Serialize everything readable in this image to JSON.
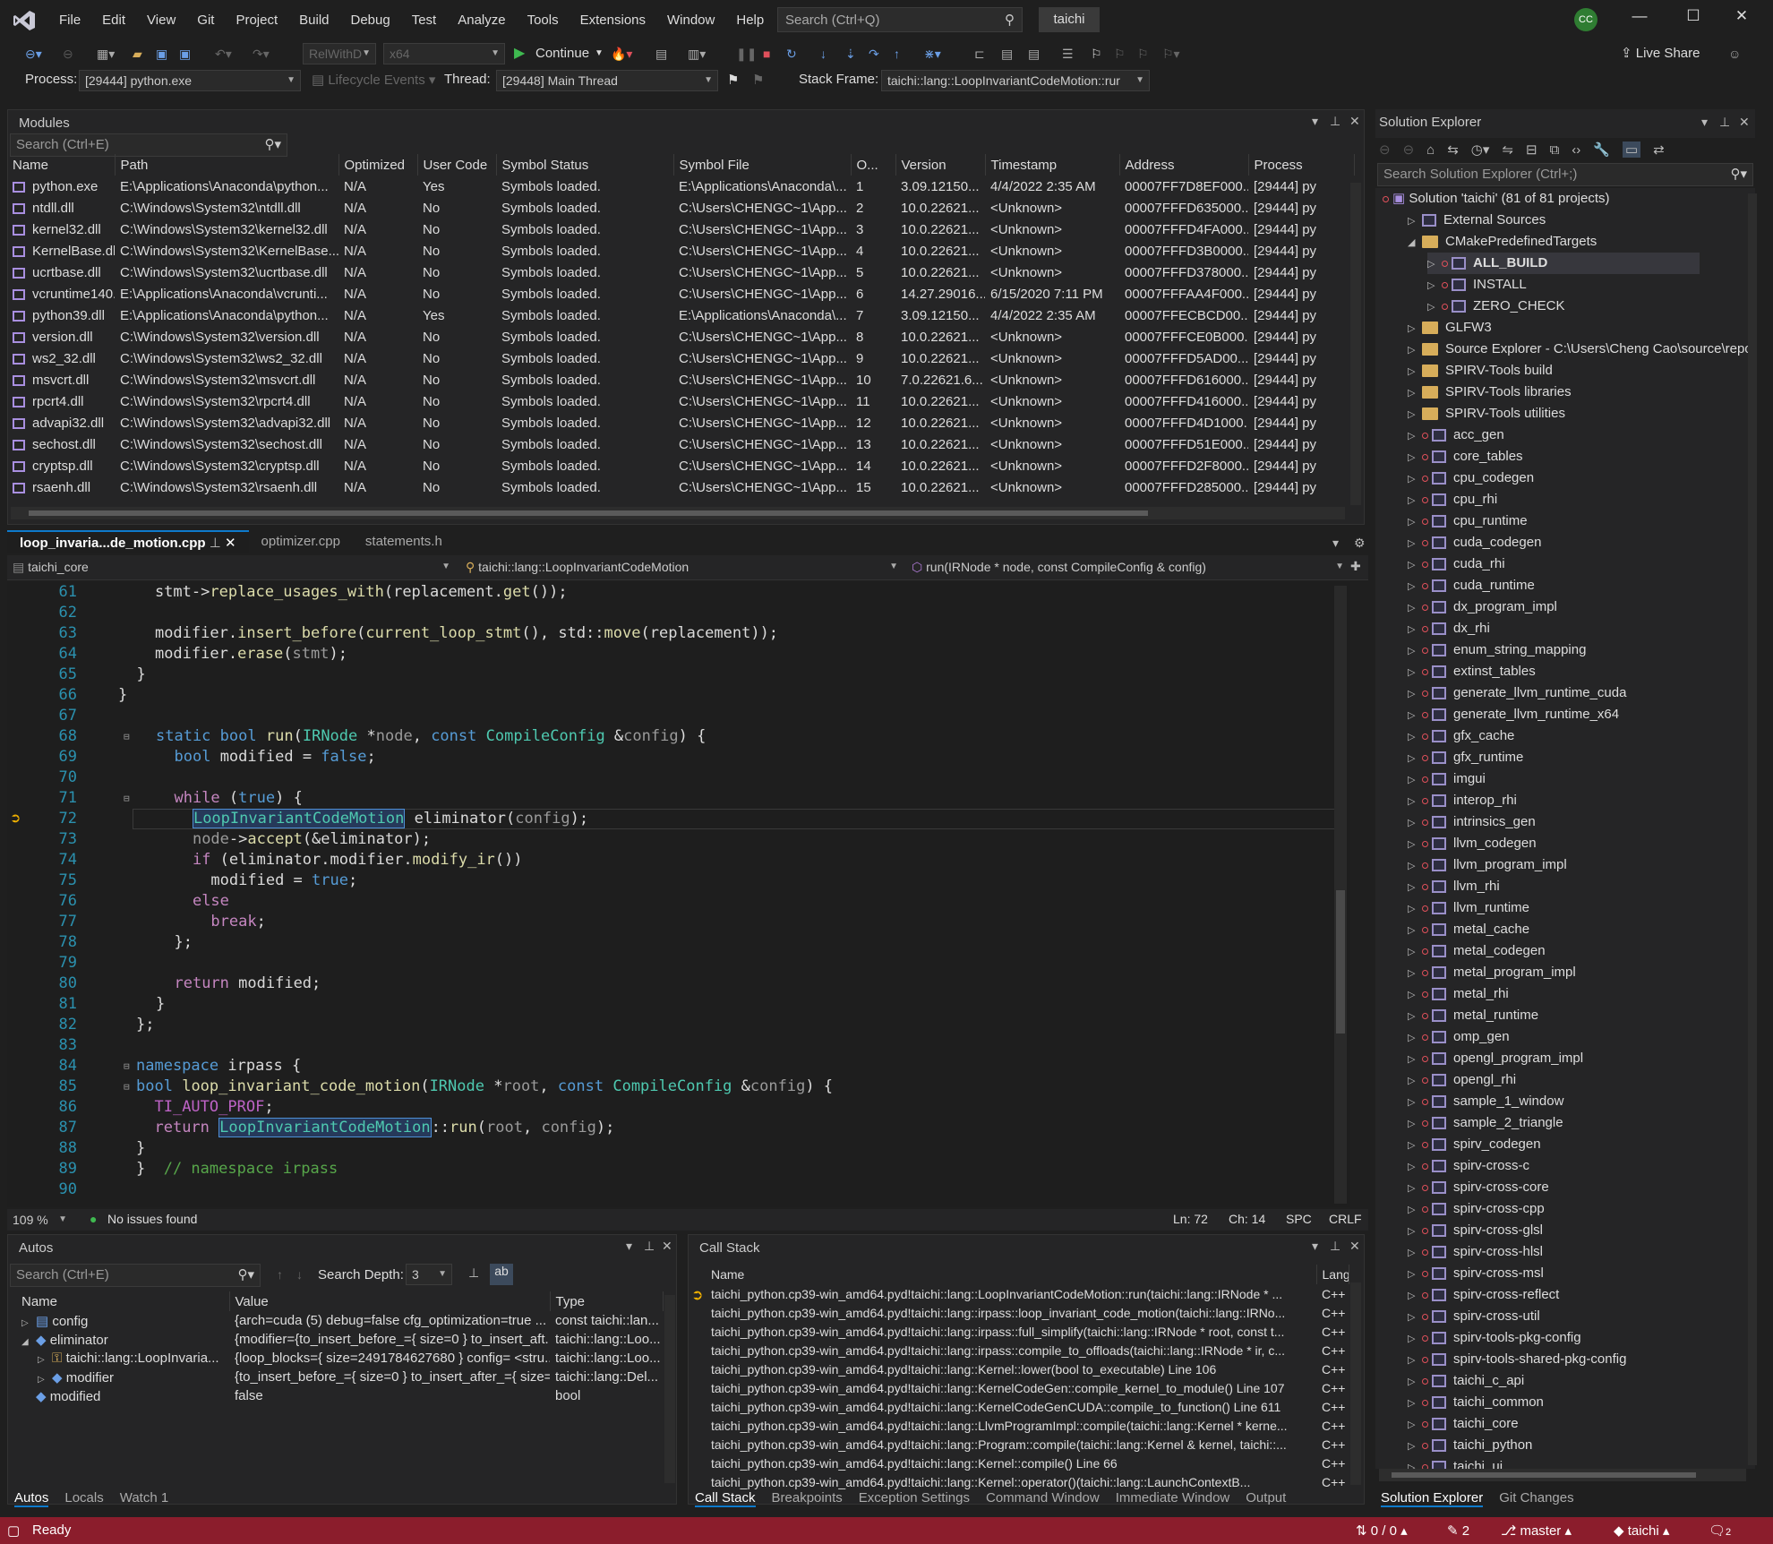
{
  "menu": {
    "items": [
      "File",
      "Edit",
      "View",
      "Git",
      "Project",
      "Build",
      "Debug",
      "Test",
      "Analyze",
      "Tools",
      "Extensions",
      "Window",
      "Help"
    ],
    "search_placeholder": "Search (Ctrl+Q)",
    "solution_name": "taichi",
    "avatar_initials": "CC"
  },
  "toolbar": {
    "config": "RelWithD",
    "platform": "x64",
    "continue_label": "Continue",
    "live_share": "Live Share"
  },
  "debug_bar": {
    "process_label": "Process:",
    "process_value": "[29444] python.exe",
    "lifecycle": "Lifecycle Events",
    "thread_label": "Thread:",
    "thread_value": "[29448] Main Thread",
    "stack_label": "Stack Frame:",
    "stack_value": "taichi::lang::LoopInvariantCodeMotion::rur"
  },
  "modules": {
    "title": "Modules",
    "search_placeholder": "Search (Ctrl+E)",
    "columns": [
      "Name",
      "Path",
      "Optimized",
      "User Code",
      "Symbol Status",
      "Symbol File",
      "O...",
      "Version",
      "Timestamp",
      "Address",
      "Process"
    ],
    "rows": [
      [
        "python.exe",
        "E:\\Applications\\Anaconda\\python...",
        "N/A",
        "Yes",
        "Symbols loaded.",
        "E:\\Applications\\Anaconda\\...",
        "1",
        "3.09.12150...",
        "4/4/2022 2:35 AM",
        "00007FF7D8EF000...",
        "[29444] py"
      ],
      [
        "ntdll.dll",
        "C:\\Windows\\System32\\ntdll.dll",
        "N/A",
        "No",
        "Symbols loaded.",
        "C:\\Users\\CHENGC~1\\App...",
        "2",
        "10.0.22621...",
        "<Unknown>",
        "00007FFFD635000...",
        "[29444] py"
      ],
      [
        "kernel32.dll",
        "C:\\Windows\\System32\\kernel32.dll",
        "N/A",
        "No",
        "Symbols loaded.",
        "C:\\Users\\CHENGC~1\\App...",
        "3",
        "10.0.22621...",
        "<Unknown>",
        "00007FFFD4FA000...",
        "[29444] py"
      ],
      [
        "KernelBase.dll",
        "C:\\Windows\\System32\\KernelBase...",
        "N/A",
        "No",
        "Symbols loaded.",
        "C:\\Users\\CHENGC~1\\App...",
        "4",
        "10.0.22621...",
        "<Unknown>",
        "00007FFFD3B0000...",
        "[29444] py"
      ],
      [
        "ucrtbase.dll",
        "C:\\Windows\\System32\\ucrtbase.dll",
        "N/A",
        "No",
        "Symbols loaded.",
        "C:\\Users\\CHENGC~1\\App...",
        "5",
        "10.0.22621...",
        "<Unknown>",
        "00007FFFD378000...",
        "[29444] py"
      ],
      [
        "vcruntime140.dll",
        "E:\\Applications\\Anaconda\\vcrunti...",
        "N/A",
        "No",
        "Symbols loaded.",
        "C:\\Users\\CHENGC~1\\App...",
        "6",
        "14.27.29016...",
        "6/15/2020 7:11 PM",
        "00007FFFAA4F000...",
        "[29444] py"
      ],
      [
        "python39.dll",
        "E:\\Applications\\Anaconda\\python...",
        "N/A",
        "Yes",
        "Symbols loaded.",
        "E:\\Applications\\Anaconda\\...",
        "7",
        "3.09.12150...",
        "4/4/2022 2:35 AM",
        "00007FFECBCD00...",
        "[29444] py"
      ],
      [
        "version.dll",
        "C:\\Windows\\System32\\version.dll",
        "N/A",
        "No",
        "Symbols loaded.",
        "C:\\Users\\CHENGC~1\\App...",
        "8",
        "10.0.22621...",
        "<Unknown>",
        "00007FFFCE0B000...",
        "[29444] py"
      ],
      [
        "ws2_32.dll",
        "C:\\Windows\\System32\\ws2_32.dll",
        "N/A",
        "No",
        "Symbols loaded.",
        "C:\\Users\\CHENGC~1\\App...",
        "9",
        "10.0.22621...",
        "<Unknown>",
        "00007FFFD5AD00...",
        "[29444] py"
      ],
      [
        "msvcrt.dll",
        "C:\\Windows\\System32\\msvcrt.dll",
        "N/A",
        "No",
        "Symbols loaded.",
        "C:\\Users\\CHENGC~1\\App...",
        "10",
        "7.0.22621.6...",
        "<Unknown>",
        "00007FFFD616000...",
        "[29444] py"
      ],
      [
        "rpcrt4.dll",
        "C:\\Windows\\System32\\rpcrt4.dll",
        "N/A",
        "No",
        "Symbols loaded.",
        "C:\\Users\\CHENGC~1\\App...",
        "11",
        "10.0.22621...",
        "<Unknown>",
        "00007FFFD416000...",
        "[29444] py"
      ],
      [
        "advapi32.dll",
        "C:\\Windows\\System32\\advapi32.dll",
        "N/A",
        "No",
        "Symbols loaded.",
        "C:\\Users\\CHENGC~1\\App...",
        "12",
        "10.0.22621...",
        "<Unknown>",
        "00007FFFD4D1000...",
        "[29444] py"
      ],
      [
        "sechost.dll",
        "C:\\Windows\\System32\\sechost.dll",
        "N/A",
        "No",
        "Symbols loaded.",
        "C:\\Users\\CHENGC~1\\App...",
        "13",
        "10.0.22621...",
        "<Unknown>",
        "00007FFFD51E000...",
        "[29444] py"
      ],
      [
        "cryptsp.dll",
        "C:\\Windows\\System32\\cryptsp.dll",
        "N/A",
        "No",
        "Symbols loaded.",
        "C:\\Users\\CHENGC~1\\App...",
        "14",
        "10.0.22621...",
        "<Unknown>",
        "00007FFFD2F8000...",
        "[29444] py"
      ],
      [
        "rsaenh.dll",
        "C:\\Windows\\System32\\rsaenh.dll",
        "N/A",
        "No",
        "Symbols loaded.",
        "C:\\Users\\CHENGC~1\\App...",
        "15",
        "10.0.22621...",
        "<Unknown>",
        "00007FFFD285000...",
        "[29444] py"
      ]
    ]
  },
  "editor": {
    "tabs": [
      "loop_invaria...de_motion.cpp",
      "optimizer.cpp",
      "statements.h"
    ],
    "nav_project": "taichi_core",
    "nav_class": "taichi::lang::LoopInvariantCodeMotion",
    "nav_member": "run(IRNode * node, const CompileConfig & config)",
    "lines": [
      "61",
      "62",
      "63",
      "64",
      "65",
      "66",
      "67",
      "68",
      "69",
      "70",
      "71",
      "72",
      "73",
      "74",
      "75",
      "76",
      "77",
      "78",
      "79",
      "80",
      "81",
      "82",
      "83",
      "84",
      "85",
      "86",
      "87",
      "88",
      "89",
      "90"
    ],
    "zoom": "109 %",
    "issues": "No issues found",
    "ln": "Ln: 72",
    "ch": "Ch: 14",
    "spc": "SPC",
    "crlf": "CRLF"
  },
  "autos": {
    "title": "Autos",
    "search_placeholder": "Search (Ctrl+E)",
    "depth_label": "Search Depth:",
    "depth_value": "3",
    "columns": [
      "Name",
      "Value",
      "Type"
    ],
    "rows": [
      [
        "config",
        "{arch=cuda (5) debug=false cfg_optimization=true ...",
        "const taichi::lan..."
      ],
      [
        "eliminator",
        "{modifier={to_insert_before_={ size=0 } to_insert_aft...",
        "taichi::lang::Loo..."
      ],
      [
        "taichi::lang::LoopInvaria...",
        "{loop_blocks={ size=2491784627680 } config= <stru...",
        "taichi::lang::Loo..."
      ],
      [
        "modifier",
        "{to_insert_before_={ size=0 } to_insert_after_={ size=...",
        "taichi::lang::Del..."
      ],
      [
        "modified",
        "false",
        "bool"
      ]
    ],
    "tabs": [
      "Autos",
      "Locals",
      "Watch 1"
    ]
  },
  "callstack": {
    "title": "Call Stack",
    "columns": [
      "Name",
      "Lang"
    ],
    "rows": [
      "taichi_python.cp39-win_amd64.pyd!taichi::lang::LoopInvariantCodeMotion::run(taichi::lang::IRNode * ...",
      "taichi_python.cp39-win_amd64.pyd!taichi::lang::irpass::loop_invariant_code_motion(taichi::lang::IRNo...",
      "taichi_python.cp39-win_amd64.pyd!taichi::lang::irpass::full_simplify(taichi::lang::IRNode * root, const t...",
      "taichi_python.cp39-win_amd64.pyd!taichi::lang::irpass::compile_to_offloads(taichi::lang::IRNode * ir, c...",
      "taichi_python.cp39-win_amd64.pyd!taichi::lang::Kernel::lower(bool to_executable) Line 106",
      "taichi_python.cp39-win_amd64.pyd!taichi::lang::KernelCodeGen::compile_kernel_to_module() Line 107",
      "taichi_python.cp39-win_amd64.pyd!taichi::lang::KernelCodeGenCUDA::compile_to_function() Line 611",
      "taichi_python.cp39-win_amd64.pyd!taichi::lang::LlvmProgramImpl::compile(taichi::lang::Kernel * kerne...",
      "taichi_python.cp39-win_amd64.pyd!taichi::lang::Program::compile(taichi::lang::Kernel & kernel, taichi::...",
      "taichi_python.cp39-win_amd64.pyd!taichi::lang::Kernel::compile() Line 66",
      "taichi_python.cp39-win_amd64.pyd!taichi::lang::Kernel::operator()(taichi::lang::LaunchContextB..."
    ],
    "lang": "C++",
    "tabs": [
      "Call Stack",
      "Breakpoints",
      "Exception Settings",
      "Command Window",
      "Immediate Window",
      "Output"
    ]
  },
  "solution": {
    "title": "Solution Explorer",
    "search_placeholder": "Search Solution Explorer (Ctrl+;)",
    "root": "Solution 'taichi' (81 of 81 projects)",
    "items": [
      {
        "label": "External Sources",
        "kind": "ext",
        "indent": 1
      },
      {
        "label": "CMakePredefinedTargets",
        "kind": "folder",
        "indent": 1,
        "open": true
      },
      {
        "label": "ALL_BUILD",
        "kind": "proj",
        "indent": 2,
        "bold": true
      },
      {
        "label": "INSTALL",
        "kind": "proj",
        "indent": 2
      },
      {
        "label": "ZERO_CHECK",
        "kind": "proj",
        "indent": 2
      },
      {
        "label": "GLFW3",
        "kind": "folder",
        "indent": 1
      },
      {
        "label": "Source Explorer - C:\\Users\\Cheng Cao\\source\\repos\\",
        "kind": "folder",
        "indent": 1
      },
      {
        "label": "SPIRV-Tools build",
        "kind": "folder",
        "indent": 1
      },
      {
        "label": "SPIRV-Tools libraries",
        "kind": "folder",
        "indent": 1
      },
      {
        "label": "SPIRV-Tools utilities",
        "kind": "folder",
        "indent": 1
      },
      {
        "label": "acc_gen",
        "kind": "proj",
        "indent": 1
      },
      {
        "label": "core_tables",
        "kind": "proj",
        "indent": 1
      },
      {
        "label": "cpu_codegen",
        "kind": "proj",
        "indent": 1
      },
      {
        "label": "cpu_rhi",
        "kind": "proj",
        "indent": 1
      },
      {
        "label": "cpu_runtime",
        "kind": "proj",
        "indent": 1
      },
      {
        "label": "cuda_codegen",
        "kind": "proj",
        "indent": 1
      },
      {
        "label": "cuda_rhi",
        "kind": "proj",
        "indent": 1
      },
      {
        "label": "cuda_runtime",
        "kind": "proj",
        "indent": 1
      },
      {
        "label": "dx_program_impl",
        "kind": "proj",
        "indent": 1
      },
      {
        "label": "dx_rhi",
        "kind": "proj",
        "indent": 1
      },
      {
        "label": "enum_string_mapping",
        "kind": "proj",
        "indent": 1
      },
      {
        "label": "extinst_tables",
        "kind": "proj",
        "indent": 1
      },
      {
        "label": "generate_llvm_runtime_cuda",
        "kind": "proj",
        "indent": 1
      },
      {
        "label": "generate_llvm_runtime_x64",
        "kind": "proj",
        "indent": 1
      },
      {
        "label": "gfx_cache",
        "kind": "proj",
        "indent": 1
      },
      {
        "label": "gfx_runtime",
        "kind": "proj",
        "indent": 1
      },
      {
        "label": "imgui",
        "kind": "proj",
        "indent": 1
      },
      {
        "label": "interop_rhi",
        "kind": "proj",
        "indent": 1
      },
      {
        "label": "intrinsics_gen",
        "kind": "proj",
        "indent": 1
      },
      {
        "label": "llvm_codegen",
        "kind": "proj",
        "indent": 1
      },
      {
        "label": "llvm_program_impl",
        "kind": "proj",
        "indent": 1
      },
      {
        "label": "llvm_rhi",
        "kind": "proj",
        "indent": 1
      },
      {
        "label": "llvm_runtime",
        "kind": "proj",
        "indent": 1
      },
      {
        "label": "metal_cache",
        "kind": "proj",
        "indent": 1
      },
      {
        "label": "metal_codegen",
        "kind": "proj",
        "indent": 1
      },
      {
        "label": "metal_program_impl",
        "kind": "proj",
        "indent": 1
      },
      {
        "label": "metal_rhi",
        "kind": "proj",
        "indent": 1
      },
      {
        "label": "metal_runtime",
        "kind": "proj",
        "indent": 1
      },
      {
        "label": "omp_gen",
        "kind": "proj",
        "indent": 1
      },
      {
        "label": "opengl_program_impl",
        "kind": "proj",
        "indent": 1
      },
      {
        "label": "opengl_rhi",
        "kind": "proj",
        "indent": 1
      },
      {
        "label": "sample_1_window",
        "kind": "proj",
        "indent": 1
      },
      {
        "label": "sample_2_triangle",
        "kind": "proj",
        "indent": 1
      },
      {
        "label": "spirv_codegen",
        "kind": "proj",
        "indent": 1
      },
      {
        "label": "spirv-cross-c",
        "kind": "proj",
        "indent": 1
      },
      {
        "label": "spirv-cross-core",
        "kind": "proj",
        "indent": 1
      },
      {
        "label": "spirv-cross-cpp",
        "kind": "proj",
        "indent": 1
      },
      {
        "label": "spirv-cross-glsl",
        "kind": "proj",
        "indent": 1
      },
      {
        "label": "spirv-cross-hlsl",
        "kind": "proj",
        "indent": 1
      },
      {
        "label": "spirv-cross-msl",
        "kind": "proj",
        "indent": 1
      },
      {
        "label": "spirv-cross-reflect",
        "kind": "proj",
        "indent": 1
      },
      {
        "label": "spirv-cross-util",
        "kind": "proj",
        "indent": 1
      },
      {
        "label": "spirv-tools-pkg-config",
        "kind": "proj",
        "indent": 1
      },
      {
        "label": "spirv-tools-shared-pkg-config",
        "kind": "proj",
        "indent": 1
      },
      {
        "label": "taichi_c_api",
        "kind": "proj",
        "indent": 1
      },
      {
        "label": "taichi_common",
        "kind": "proj",
        "indent": 1
      },
      {
        "label": "taichi_core",
        "kind": "proj",
        "indent": 1
      },
      {
        "label": "taichi_python",
        "kind": "proj",
        "indent": 1
      },
      {
        "label": "taichi_ui",
        "kind": "proj",
        "indent": 1
      }
    ],
    "tabs": [
      "Solution Explorer",
      "Git Changes"
    ]
  },
  "statusbar": {
    "ready": "Ready",
    "updown": "0 / 0",
    "pencil": "2",
    "branch": "master",
    "repo": "taichi",
    "notif": "2"
  }
}
